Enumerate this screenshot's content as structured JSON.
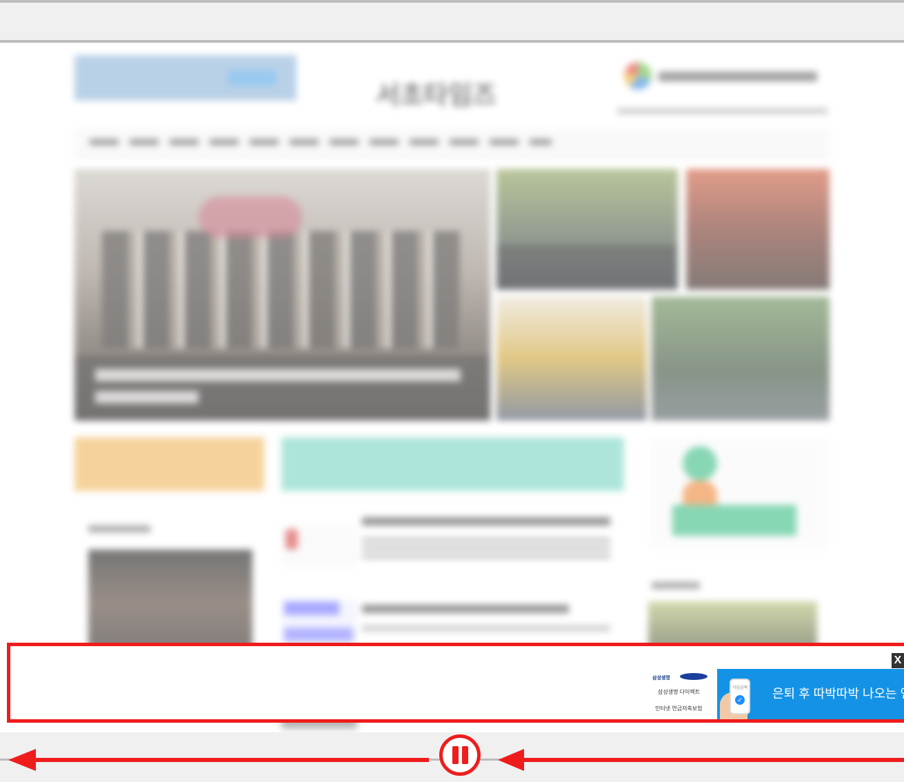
{
  "page": {
    "site_logo": "서초타임즈",
    "nav_items": [
      "",
      "",
      "",
      "",
      "",
      "",
      "",
      "",
      "",
      "",
      "",
      "",
      ""
    ]
  },
  "ad": {
    "close_label": "X",
    "brand_line": "삼성생명",
    "brand_sub": "삼성생명 다이렉트",
    "brand_product": "인터넷 연금저축보험",
    "phone_label": "가입금액",
    "headline": "은퇴 후 따박따박 나오는 연"
  },
  "colors": {
    "annotation": "#ef1c1c",
    "ad_blue": "#1493e6",
    "toolbar": "#f0f0f0"
  }
}
